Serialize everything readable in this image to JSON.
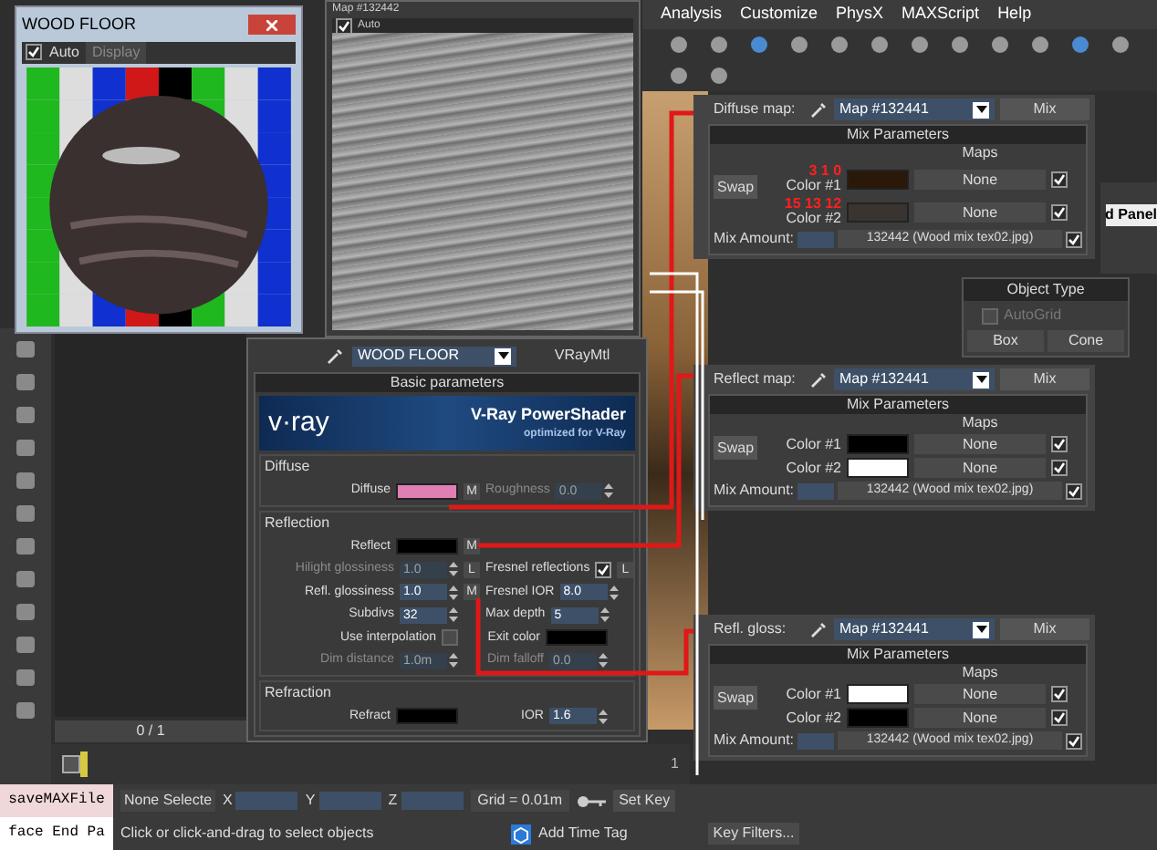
{
  "preview_window": {
    "title": "WOOD FLOOR",
    "auto": {
      "label": "Auto",
      "checked": true
    },
    "tab": "Display"
  },
  "map_window": {
    "title": "Map #132442",
    "auto": {
      "label": "Auto",
      "checked": true
    }
  },
  "menu_bar": [
    "Analysis",
    "Customize",
    "PhysX",
    "MAXScript",
    "Help"
  ],
  "mix_panels": [
    {
      "label": "Diffuse map:",
      "map": "Map #132441",
      "type": "Mix",
      "header": "Mix Parameters",
      "maps_label": "Maps",
      "swap": "Swap",
      "colors": [
        {
          "label": "Color #1",
          "color": "#2a1808",
          "map": "None",
          "checked": true,
          "annotation": "3 1 0"
        },
        {
          "label": "Color #2",
          "color": "#3a3430",
          "map": "None",
          "checked": true,
          "annotation": "15 13 12"
        }
      ],
      "mix_amount": {
        "label": "Mix Amount:",
        "map": "132442 (Wood mix tex02.jpg)",
        "checked": true
      }
    },
    {
      "label": "Reflect map:",
      "map": "Map #132441",
      "type": "Mix",
      "header": "Mix Parameters",
      "maps_label": "Maps",
      "swap": "Swap",
      "colors": [
        {
          "label": "Color #1",
          "color": "#000000",
          "map": "None",
          "checked": true
        },
        {
          "label": "Color #2",
          "color": "#ffffff",
          "map": "None",
          "checked": true
        }
      ],
      "mix_amount": {
        "label": "Mix Amount:",
        "map": "132442 (Wood mix tex02.jpg)",
        "checked": true
      }
    },
    {
      "label": "Refl. gloss:",
      "map": "Map #132441",
      "type": "Mix",
      "header": "Mix Parameters",
      "maps_label": "Maps",
      "swap": "Swap",
      "colors": [
        {
          "label": "Color #1",
          "color": "#ffffff",
          "map": "None",
          "checked": true
        },
        {
          "label": "Color #2",
          "color": "#000000",
          "map": "None",
          "checked": true
        }
      ],
      "mix_amount": {
        "label": "Mix Amount:",
        "map": "132442 (Wood mix tex02.jpg)",
        "checked": true
      }
    }
  ],
  "command_panel": {
    "title": "d Panel",
    "rollout": "Object Type",
    "autogrid": {
      "label": "AutoGrid",
      "checked": false
    },
    "buttons": [
      "Box",
      "Cone"
    ]
  },
  "material_editor": {
    "name": "WOOD FLOOR",
    "type": "VRayMtl",
    "rollout": "Basic parameters",
    "banner": {
      "logo": "v·ray",
      "title": "V-Ray PowerShader",
      "subtitle": "optimized for V-Ray"
    },
    "groups": [
      {
        "title": "Diffuse",
        "rows": [
          [
            {
              "kind": "swatch",
              "label": "Diffuse",
              "color": "#e07fb4",
              "button": "M"
            },
            {
              "kind": "spinner",
              "label": "Roughness",
              "value": "0.0",
              "disabled": true
            }
          ]
        ]
      },
      {
        "title": "Reflection",
        "rows": [
          [
            {
              "kind": "swatch",
              "label": "Reflect",
              "color": "#000000",
              "button": "M"
            }
          ],
          [
            {
              "kind": "spinner",
              "label": "Hilight glossiness",
              "value": "1.0",
              "disabled": true,
              "button": "L"
            },
            {
              "kind": "check",
              "label": "Fresnel reflections",
              "checked": true,
              "button": "L"
            }
          ],
          [
            {
              "kind": "spinner",
              "label": "Refl. glossiness",
              "value": "1.0",
              "button": "M"
            },
            {
              "kind": "spinner",
              "label": "Fresnel IOR",
              "value": "8.0"
            }
          ],
          [
            {
              "kind": "spinner",
              "label": "Subdivs",
              "value": "32"
            },
            {
              "kind": "spinner",
              "label": "Max depth",
              "value": "5"
            }
          ],
          [
            {
              "kind": "check",
              "label": "Use interpolation",
              "checked": false
            },
            {
              "kind": "swatch",
              "label": "Exit color",
              "color": "#000000"
            }
          ],
          [
            {
              "kind": "spinner",
              "label": "Dim distance",
              "value": "1.0m",
              "disabled": true
            },
            {
              "kind": "spinner",
              "label": "Dim falloff",
              "value": "0.0",
              "disabled": true
            }
          ]
        ]
      },
      {
        "title": "Refraction",
        "rows": [
          [
            {
              "kind": "swatch",
              "label": "Refract",
              "color": "#000000"
            },
            {
              "kind": "spinner",
              "label": "IOR",
              "value": "1.6"
            }
          ]
        ]
      }
    ]
  },
  "timeline": {
    "frame": "0 / 1",
    "end": "1"
  },
  "status_bar": {
    "script_lines": [
      "saveMAXFile",
      "face End Pa"
    ],
    "selection": "None Selecte",
    "axes": [
      "X",
      "Y",
      "Z"
    ],
    "grid": "Grid = 0.01m",
    "prompt": "Click or click-and-drag to select objects",
    "time_tag": "Add Time Tag",
    "set_key": "Set Key",
    "key_filters": "Key Filters..."
  }
}
